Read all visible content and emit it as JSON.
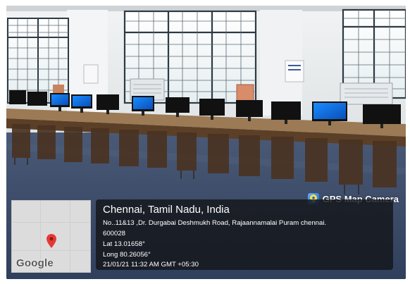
{
  "app_badge": {
    "label": "GPS Map Camera",
    "icon": "camera-pin-icon"
  },
  "location": {
    "title": "Chennai, Tamil Nadu, India",
    "address_line1": "No..11&13 ,Dr. Durgabai Deshmukh Road, Rajaannamalai Puram chennai.",
    "address_line2": "600028",
    "latitude": "Lat 13.01658°",
    "longitude": "Long 80.26056°",
    "timestamp": "21/01/21 11:32 AM GMT +05:30"
  },
  "map": {
    "brand": "Google",
    "pin_icon": "map-pin-icon",
    "pin_color": "#e53935"
  },
  "colors": {
    "floor": "#3c4f6e",
    "wall": "#e9ecee",
    "desk": "#6b4a2e"
  }
}
